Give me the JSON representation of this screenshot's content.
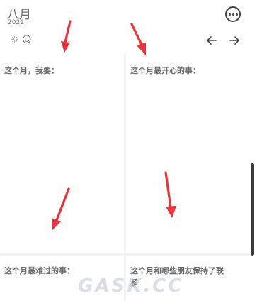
{
  "header": {
    "month": "八月",
    "year": "2021",
    "more_icon": "more-horizontal-circle-icon"
  },
  "toolbar": {
    "icons": [
      "sun-icon",
      "smiley-icon"
    ],
    "sun": "☼",
    "smiley": "☺",
    "nav": [
      "arrow-left-icon",
      "arrow-right-icon"
    ]
  },
  "cells": [
    {
      "label": "这个月，我要："
    },
    {
      "label": "这个月最开心的事："
    },
    {
      "label": "这个月最难过的事："
    },
    {
      "label": "这个月和哪些朋友保持了联",
      "second_line": "系"
    }
  ],
  "overlay": {
    "watermark": "GASK.CC",
    "arrow_color": "#e8333a"
  },
  "colors": {
    "background": "#ffffff",
    "divider": "#f2f2f2",
    "text": "#6b6b6b"
  }
}
